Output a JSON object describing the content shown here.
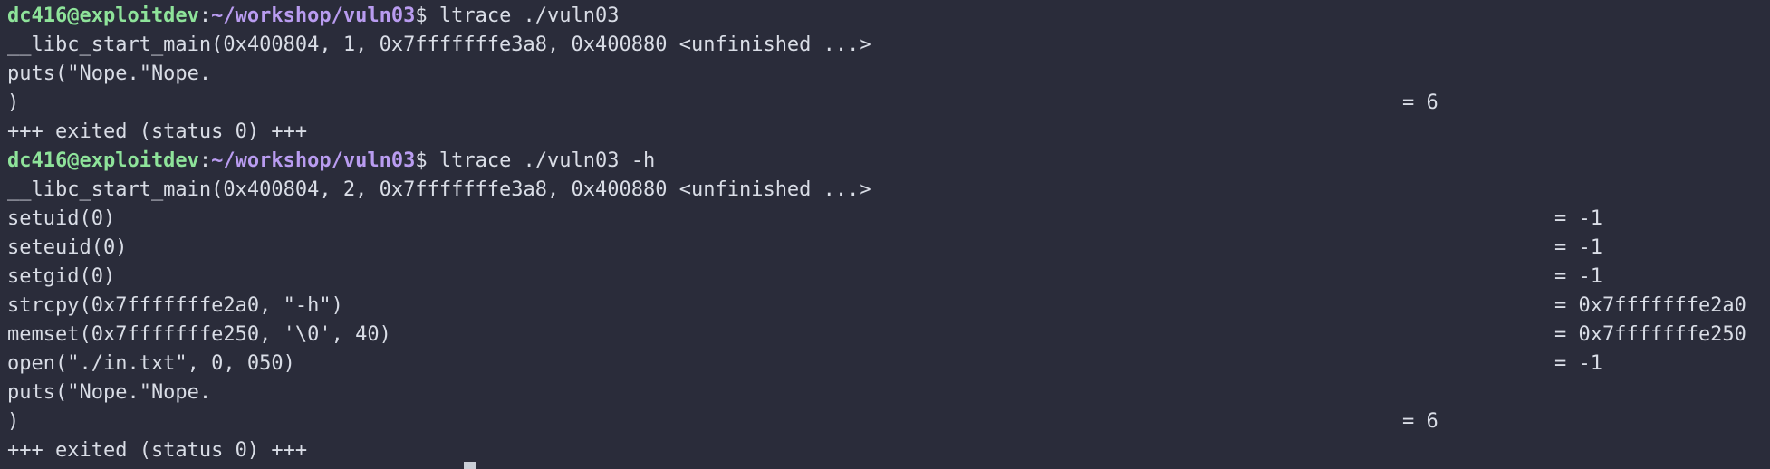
{
  "prompt": {
    "user_host": "dc416@exploitdev",
    "separator": ":",
    "path": "~/workshop/vuln03",
    "symbol": "$"
  },
  "lines": [
    {
      "type": "prompt",
      "command": " ltrace ./vuln03"
    },
    {
      "type": "text",
      "text": "__libc_start_main(0x400804, 1, 0x7fffffffe3a8, 0x400880 <unfinished ...>"
    },
    {
      "type": "text",
      "text": "puts(\"Nope.\"Nope."
    },
    {
      "type": "ret_short",
      "text": ")",
      "ret": "= 6"
    },
    {
      "type": "text",
      "text": "+++ exited (status 0) +++"
    },
    {
      "type": "prompt",
      "command": " ltrace ./vuln03 -h"
    },
    {
      "type": "text",
      "text": "__libc_start_main(0x400804, 2, 0x7fffffffe3a8, 0x400880 <unfinished ...>"
    },
    {
      "type": "ret_long",
      "text": "setuid(0)",
      "ret": "= -1"
    },
    {
      "type": "ret_long",
      "text": "seteuid(0)",
      "ret": "= -1"
    },
    {
      "type": "ret_long",
      "text": "setgid(0)",
      "ret": "= -1"
    },
    {
      "type": "ret_long",
      "text": "strcpy(0x7fffffffe2a0, \"-h\")",
      "ret": "= 0x7fffffffe2a0"
    },
    {
      "type": "ret_long",
      "text": "memset(0x7fffffffe250, '\\0', 40)",
      "ret": "= 0x7fffffffe250"
    },
    {
      "type": "ret_long",
      "text": "open(\"./in.txt\", 0, 050)",
      "ret": "= -1"
    },
    {
      "type": "text",
      "text": "puts(\"Nope.\"Nope."
    },
    {
      "type": "ret_short",
      "text": ")",
      "ret": "= 6"
    },
    {
      "type": "text",
      "text": "+++ exited (status 0) +++"
    }
  ]
}
